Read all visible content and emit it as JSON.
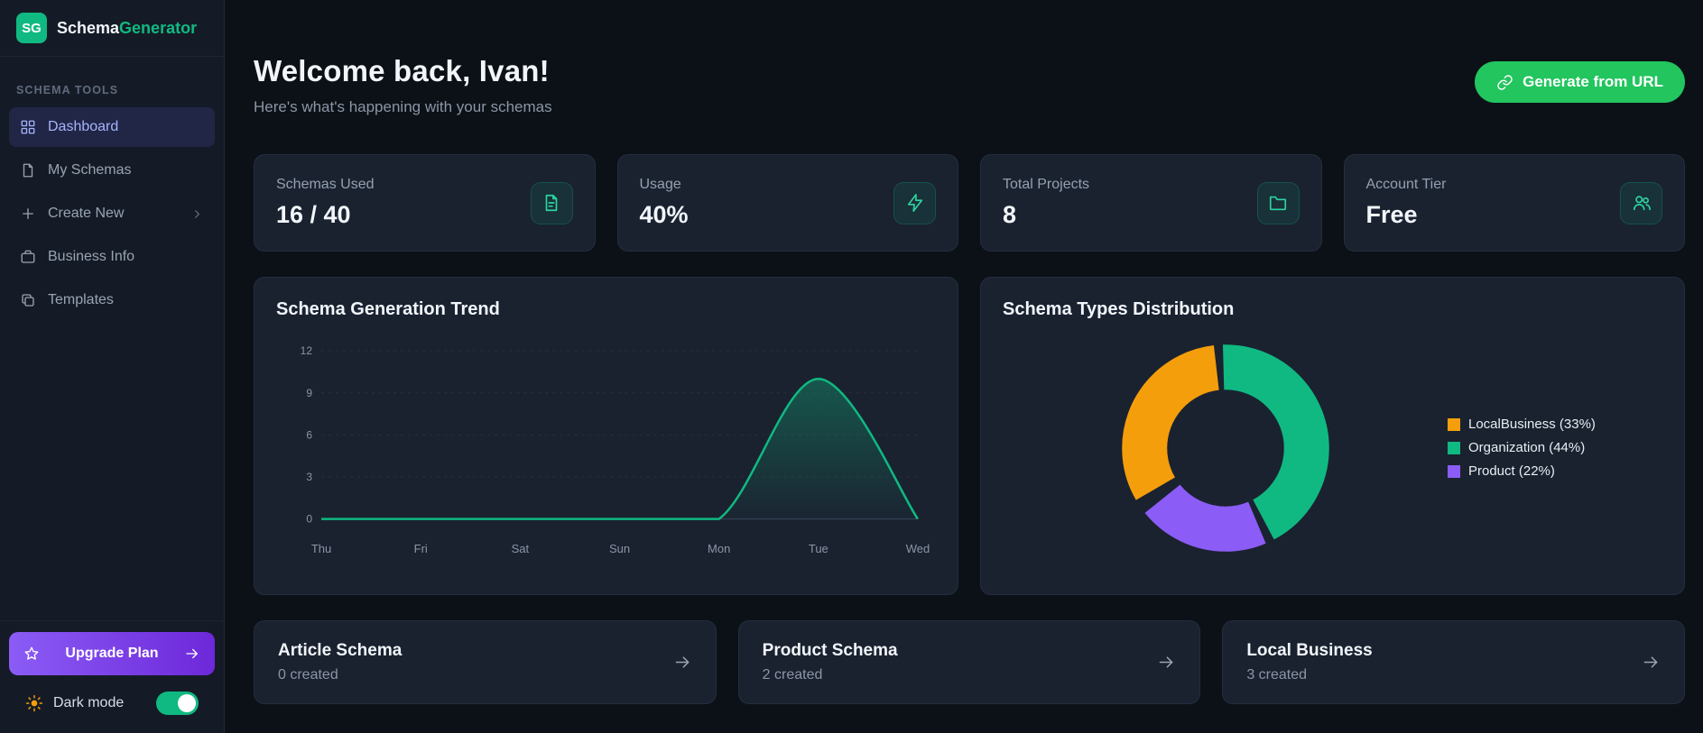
{
  "app": {
    "logo_initials": "SG",
    "name_primary": "Schema",
    "name_accent": "Generator"
  },
  "sidebar": {
    "section_label": "SCHEMA TOOLS",
    "items": [
      {
        "label": "Dashboard",
        "icon": "grid-icon",
        "active": true
      },
      {
        "label": "My Schemas",
        "icon": "file-icon",
        "active": false
      },
      {
        "label": "Create New",
        "icon": "plus-icon",
        "active": false,
        "has_chevron": true
      },
      {
        "label": "Business Info",
        "icon": "briefcase-icon",
        "active": false
      },
      {
        "label": "Templates",
        "icon": "template-icon",
        "active": false
      }
    ],
    "upgrade_label": "Upgrade Plan",
    "dark_mode_label": "Dark mode",
    "dark_mode_on": true
  },
  "header": {
    "title": "Welcome back, Ivan!",
    "subtitle": "Here's what's happening with your schemas",
    "generate_button": "Generate from URL"
  },
  "stats": [
    {
      "label": "Schemas Used",
      "value": "16 / 40",
      "icon": "file-text-icon"
    },
    {
      "label": "Usage",
      "value": "40%",
      "icon": "bolt-icon"
    },
    {
      "label": "Total Projects",
      "value": "8",
      "icon": "folder-icon"
    },
    {
      "label": "Account Tier",
      "value": "Free",
      "icon": "users-icon"
    }
  ],
  "chart_data": [
    {
      "type": "area",
      "title": "Schema Generation Trend",
      "x": [
        "Thu",
        "Fri",
        "Sat",
        "Sun",
        "Mon",
        "Tue",
        "Wed"
      ],
      "values": [
        0,
        0,
        0,
        0,
        0,
        10,
        0
      ],
      "ylim": [
        0,
        12
      ],
      "yticks": [
        0,
        3,
        6,
        9,
        12
      ],
      "grid": "dashed-horizontal",
      "line_color": "#10b981",
      "legend_position": "none"
    },
    {
      "type": "pie",
      "donut": true,
      "title": "Schema Types Distribution",
      "legend_position": "right",
      "slices": [
        {
          "name": "LocalBusiness",
          "value": 33,
          "label": "LocalBusiness (33%)",
          "color": "#f59e0b"
        },
        {
          "name": "Organization",
          "value": 44,
          "label": "Organization (44%)",
          "color": "#10b981"
        },
        {
          "name": "Product",
          "value": 22,
          "label": "Product (22%)",
          "color": "#8b5cf6"
        }
      ],
      "layout_note": "Organization starts at 12 o'clock going clockwise, then Product, then LocalBusiness"
    }
  ],
  "quick_cards": [
    {
      "title": "Article Schema",
      "subtitle": "0 created"
    },
    {
      "title": "Product Schema",
      "subtitle": "2 created"
    },
    {
      "title": "Local Business",
      "subtitle": "3 created"
    }
  ],
  "colors": {
    "accent_green": "#10b981",
    "button_green": "#22c55e",
    "upgrade_purple": "#7c3aed",
    "active_nav": "#a5b4fc",
    "slice_orange": "#f59e0b",
    "slice_green": "#10b981",
    "slice_purple": "#8b5cf6"
  }
}
